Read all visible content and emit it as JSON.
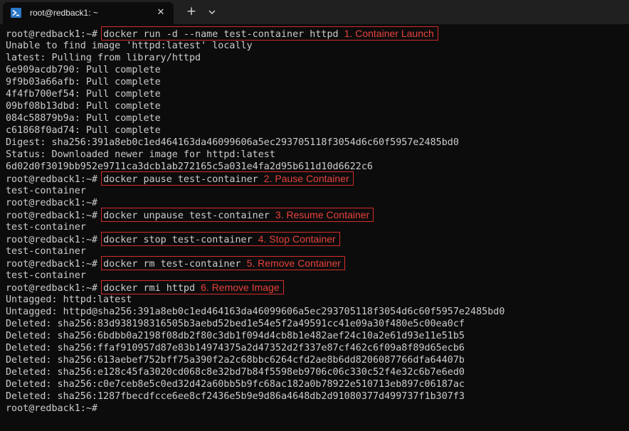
{
  "window": {
    "tab_title": "root@redback1: ~",
    "tab_icon": "powershell-icon",
    "close_icon": "✕",
    "new_tab_icon": "+",
    "dropdown_icon": "chevron-down-icon"
  },
  "colors": {
    "background": "#0c0c0c",
    "titlebar": "#202020",
    "text": "#cccccc",
    "annotation": "#e8423d",
    "highlight_border": "#d42a2a"
  },
  "terminal": {
    "lines": [
      {
        "prompt": "root@redback1:~# ",
        "command": "docker run -d --name test-container httpd",
        "annotation": "1. Container Launch"
      },
      {
        "text": "Unable to find image 'httpd:latest' locally"
      },
      {
        "text": "latest: Pulling from library/httpd"
      },
      {
        "text": "6e909acdb790: Pull complete"
      },
      {
        "text": "9f9b03a66afb: Pull complete"
      },
      {
        "text": "4f4fb700ef54: Pull complete"
      },
      {
        "text": "09bf08b13dbd: Pull complete"
      },
      {
        "text": "084c58879b9a: Pull complete"
      },
      {
        "text": "c61868f0ad74: Pull complete"
      },
      {
        "text": "Digest: sha256:391a8eb0c1ed464163da46099606a5ec293705118f3054d6c60f5957e2485bd0"
      },
      {
        "text": "Status: Downloaded newer image for httpd:latest"
      },
      {
        "text": "6d02d0f3019bb952e9711ca3dcb1ab272165c5a031e4fa2d95b611d10d6622c6"
      },
      {
        "prompt": "root@redback1:~# ",
        "command": "docker pause test-container",
        "annotation": "2. Pause Container"
      },
      {
        "text": "test-container"
      },
      {
        "text": "root@redback1:~#"
      },
      {
        "prompt": "root@redback1:~# ",
        "command": "docker unpause test-container",
        "annotation": "3. Resume Container"
      },
      {
        "text": "test-container"
      },
      {
        "prompt": "root@redback1:~# ",
        "command": "docker stop test-container",
        "annotation": "4. Stop Container"
      },
      {
        "text": "test-container"
      },
      {
        "prompt": "root@redback1:~# ",
        "command": "docker rm test-container",
        "annotation": "5. Remove Container"
      },
      {
        "text": "test-container"
      },
      {
        "prompt": "root@redback1:~# ",
        "command": "docker rmi httpd",
        "annotation": "6. Remove Image"
      },
      {
        "text": "Untagged: httpd:latest"
      },
      {
        "text": "Untagged: httpd@sha256:391a8eb0c1ed464163da46099606a5ec293705118f3054d6c60f5957e2485bd0"
      },
      {
        "text": "Deleted: sha256:83d938198316505b3aebd52bed1e54e5f2a49591cc41e09a30f480e5c00ea0cf"
      },
      {
        "text": "Deleted: sha256:6bdbb0a2198f08db2f80c3db1f094d4cb8b1e482aef24c10a2e61d93e11e51b5"
      },
      {
        "text": "Deleted: sha256:ffaf910957d87e83b14974375a2d47352d2f337e87cf462c6f09a8f89d65ecb6"
      },
      {
        "text": "Deleted: sha256:613aebef752bff75a390f2a2c68bbc6264cfd2ae8b6dd8206087766dfa64407b"
      },
      {
        "text": "Deleted: sha256:e128c45fa3020cd068c8e32bd7b84f5598eb9706c06c330c52f4e32c6b7e6ed0"
      },
      {
        "text": "Deleted: sha256:c0e7ceb8e5c0ed32d42a60bb5b9fc68ac182a0b78922e510713eb897c06187ac"
      },
      {
        "text": "Deleted: sha256:1287fbecdfcce6ee8cf2436e5b9e9d86a4648db2d91080377d499737f1b307f3"
      },
      {
        "text": "root@redback1:~#"
      }
    ]
  }
}
